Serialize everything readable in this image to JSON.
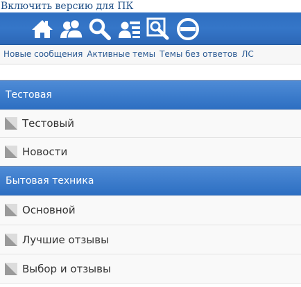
{
  "pc_version_link": "Включить версию для ПК",
  "topbar": {
    "icons": [
      "home-icon",
      "members-icon",
      "search-icon",
      "user-list-icon",
      "search-settings-icon",
      "no-entry-icon"
    ]
  },
  "quicklinks": {
    "new_posts": "Новые сообщения",
    "active_topics": "Активные темы",
    "unanswered": "Темы без ответов",
    "pm": "ЛС"
  },
  "categories": [
    {
      "title": "Тестовая",
      "forums": [
        "Тестовый",
        "Новости"
      ]
    },
    {
      "title": "Бытовая техника",
      "forums": [
        "Основной",
        "Лучшие отзывы",
        "Выбор и отзывы"
      ]
    }
  ],
  "colors": {
    "header_blue": "#2f6fc0",
    "category_blue": "#3a7cce",
    "link_blue": "#2b5a93"
  }
}
